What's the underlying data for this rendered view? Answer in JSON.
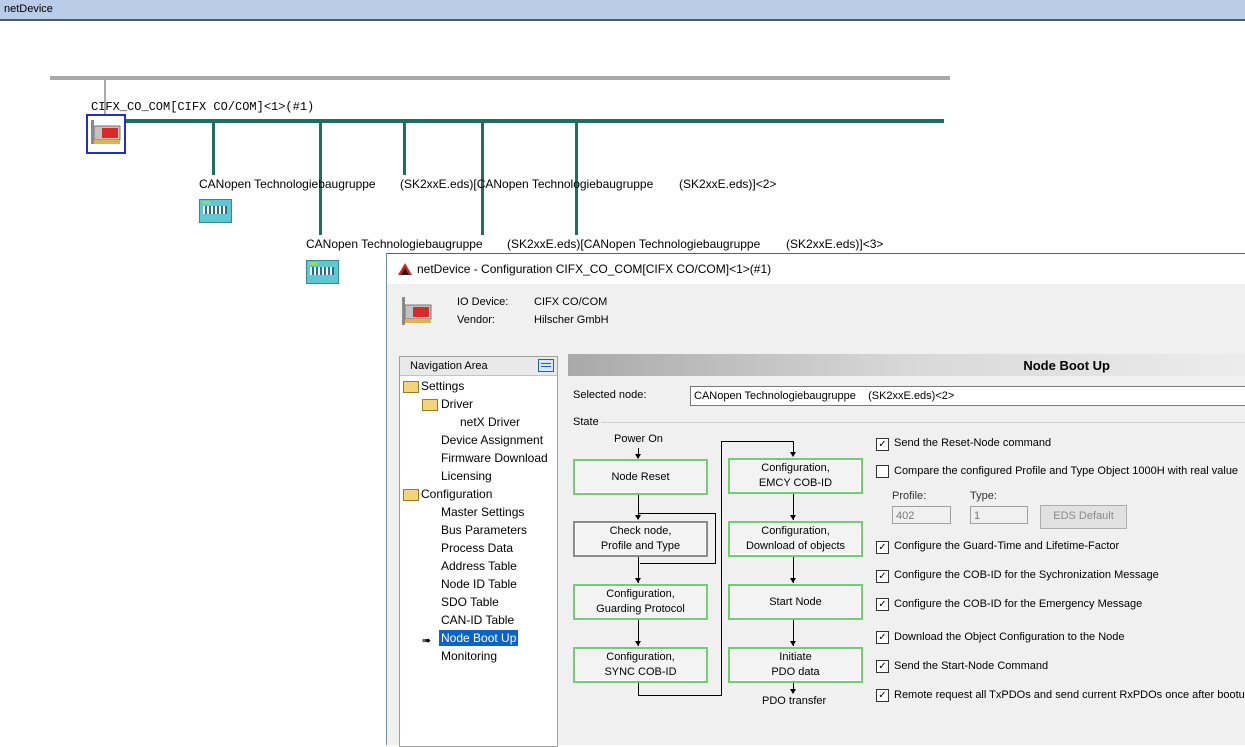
{
  "window": {
    "title": "netDevice"
  },
  "network": {
    "master_label": "CIFX_CO_COM[CIFX CO/COM]<1>(#1)",
    "slave1_name": "CANopen Technologiebaugruppe",
    "slave1_eds": "(SK2xxE.eds)[CANopen Technologiebaugruppe",
    "slave1_suffix": "(SK2xxE.eds)]<2>",
    "slave2_name": "CANopen Technologiebaugruppe",
    "slave2_eds": "(SK2xxE.eds)[CANopen Technologiebaugruppe",
    "slave2_suffix": "(SK2xxE.eds)]<3>",
    "colors": {
      "bus": "#1e6f5c",
      "top_line": "#a9a9a9"
    }
  },
  "dialog": {
    "title": "netDevice - Configuration CIFX_CO_COM[CIFX CO/COM]<1>(#1)",
    "io_device_label": "IO Device:",
    "io_device_value": "CIFX CO/COM",
    "vendor_label": "Vendor:",
    "vendor_value": "Hilscher GmbH"
  },
  "navigation": {
    "header": "Navigation Area",
    "settings": "Settings",
    "driver": "Driver",
    "netx_driver": "netX Driver",
    "device_assignment": "Device Assignment",
    "firmware_download": "Firmware Download",
    "licensing": "Licensing",
    "configuration": "Configuration",
    "master_settings": "Master Settings",
    "bus_parameters": "Bus Parameters",
    "process_data": "Process Data",
    "address_table": "Address Table",
    "node_id_table": "Node ID Table",
    "sdo_table": "SDO Table",
    "can_id_table": "CAN-ID Table",
    "node_boot_up": "Node Boot Up",
    "monitoring": "Monitoring",
    "selected": "Node Boot Up"
  },
  "main": {
    "header": "Node Boot Up",
    "selected_node_label": "Selected node:",
    "selected_node_value": "CANopen Technologiebaugruppe    (SK2xxE.eds)<2>",
    "state_label": "State"
  },
  "flow": {
    "power_on": "Power On",
    "node_reset": "Node Reset",
    "check_node_l1": "Check node,",
    "check_node_l2": "Profile and Type",
    "guarding_l1": "Configuration,",
    "guarding_l2": "Guarding Protocol",
    "sync_l1": "Configuration,",
    "sync_l2": "SYNC COB-ID",
    "emcy_l1": "Configuration,",
    "emcy_l2": "EMCY COB-ID",
    "download_l1": "Configuration,",
    "download_l2": "Download of objects",
    "start_node": "Start Node",
    "initiate_l1": "Initiate",
    "initiate_l2": "PDO data",
    "pdo_transfer": "PDO transfer"
  },
  "options": {
    "reset_node": {
      "label": "Send the Reset-Node command",
      "checked": true
    },
    "compare_profile": {
      "label": "Compare the configured Profile and Type Object 1000H with real value",
      "checked": false
    },
    "profile_label": "Profile:",
    "profile_value": "402",
    "type_label": "Type:",
    "type_value": "1",
    "eds_default": "EDS Default",
    "guard_time": {
      "label": "Configure the Guard-Time and Lifetime-Factor",
      "checked": true
    },
    "cob_sync": {
      "label": "Configure the COB-ID for the Sychronization Message",
      "checked": true
    },
    "cob_emcy": {
      "label": "Configure the COB-ID for the Emergency Message",
      "checked": true
    },
    "download_obj": {
      "label": "Download the Object Configuration to the Node",
      "checked": true
    },
    "start_node_cmd": {
      "label": "Send the Start-Node Command",
      "checked": true
    },
    "remote_request": {
      "label": "Remote request all TxPDOs and send current RxPDOs once after bootup",
      "checked": true
    }
  }
}
